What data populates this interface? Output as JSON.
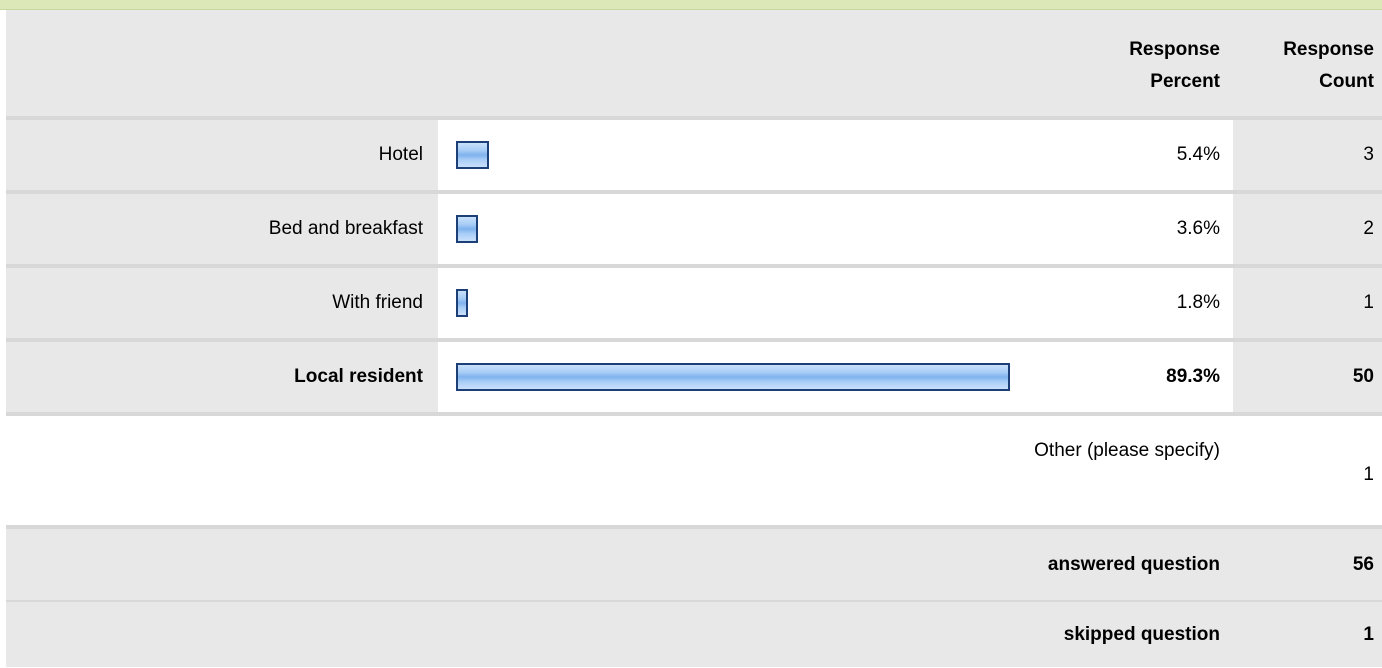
{
  "header": {
    "percent_line1": "Response",
    "percent_line2": "Percent",
    "count_line1": "Response",
    "count_line2": "Count"
  },
  "answers": [
    {
      "label": "Hotel",
      "percent_text": "5.4%",
      "percent": 5.4,
      "count": "3",
      "bold": false
    },
    {
      "label": "Bed and breakfast",
      "percent_text": "3.6%",
      "percent": 3.6,
      "count": "2",
      "bold": false
    },
    {
      "label": "With friend",
      "percent_text": "1.8%",
      "percent": 1.8,
      "count": "1",
      "bold": false
    },
    {
      "label": "Local resident",
      "percent_text": "89.3%",
      "percent": 89.3,
      "count": "50",
      "bold": true
    }
  ],
  "other": {
    "label": "Other (please specify)",
    "count": "1"
  },
  "summary": {
    "answered_label": "answered question",
    "answered_count": "56",
    "skipped_label": "skipped question",
    "skipped_count": "1"
  },
  "colors": {
    "header_bg": "#e8e8e8",
    "top_strip": "#dde8b8",
    "bar_border": "#1c3f78",
    "bar_fill": "#a9cdf6"
  }
}
